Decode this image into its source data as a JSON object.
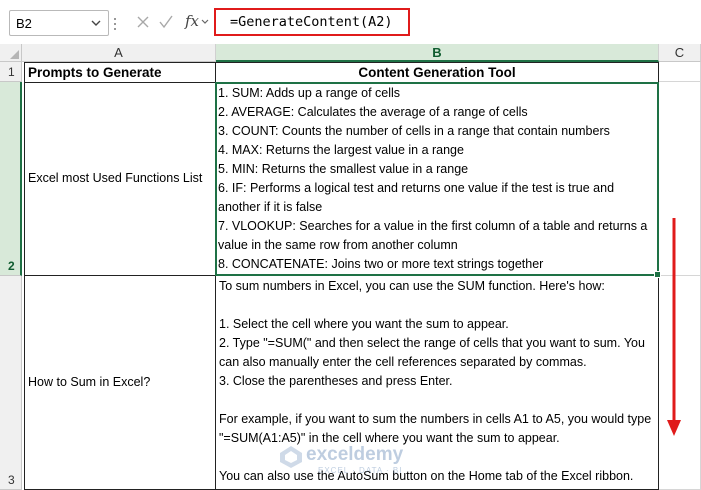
{
  "formula_bar": {
    "name_box": "B2",
    "fx_label": "fx",
    "formula": "=GenerateContent(A2)"
  },
  "columns": [
    "A",
    "B",
    "C"
  ],
  "rows": [
    "1",
    "2",
    "3"
  ],
  "cells": {
    "A1": "Prompts to Generate Content",
    "B1": "Content Generation Tool",
    "A2": "Excel most Used Functions List",
    "B2_lines": [
      "1. SUM: Adds up a range of cells",
      "2. AVERAGE: Calculates the average of a range of cells",
      "3. COUNT: Counts the number of cells in a range that contain numbers",
      "4. MAX: Returns the largest value in a range",
      "5. MIN: Returns the smallest value in a range",
      "6. IF: Performs a logical test and returns one value if the test is true and",
      "another if it is false",
      "7. VLOOKUP: Searches for a value in the first column of a table and returns a",
      "value in the same row from another column",
      "8. CONCATENATE: Joins two or more text strings together"
    ],
    "A3": "How to Sum in Excel?",
    "B3_lines": [
      "To sum numbers in Excel, you can use the SUM function. Here's how:",
      "",
      "1. Select the cell where you want the sum to appear.",
      "2. Type \"=SUM(\" and then select the range of cells that you want to sum. You",
      "can also manually enter the cell references separated by commas.",
      "3. Close the parentheses and press Enter.",
      "",
      "For example, if you want to sum the numbers in cells A1 to A5, you would type",
      "\"=SUM(A1:A5)\" in the cell where you want the sum to appear.",
      "",
      "You can also use the AutoSum button on the Home tab of the Excel ribbon."
    ]
  },
  "watermark": {
    "name": "exceldemy",
    "tagline": "EXCEL · DATA · BI"
  },
  "colors": {
    "selection": "#1e7145",
    "highlight_red": "#e01b1b"
  }
}
